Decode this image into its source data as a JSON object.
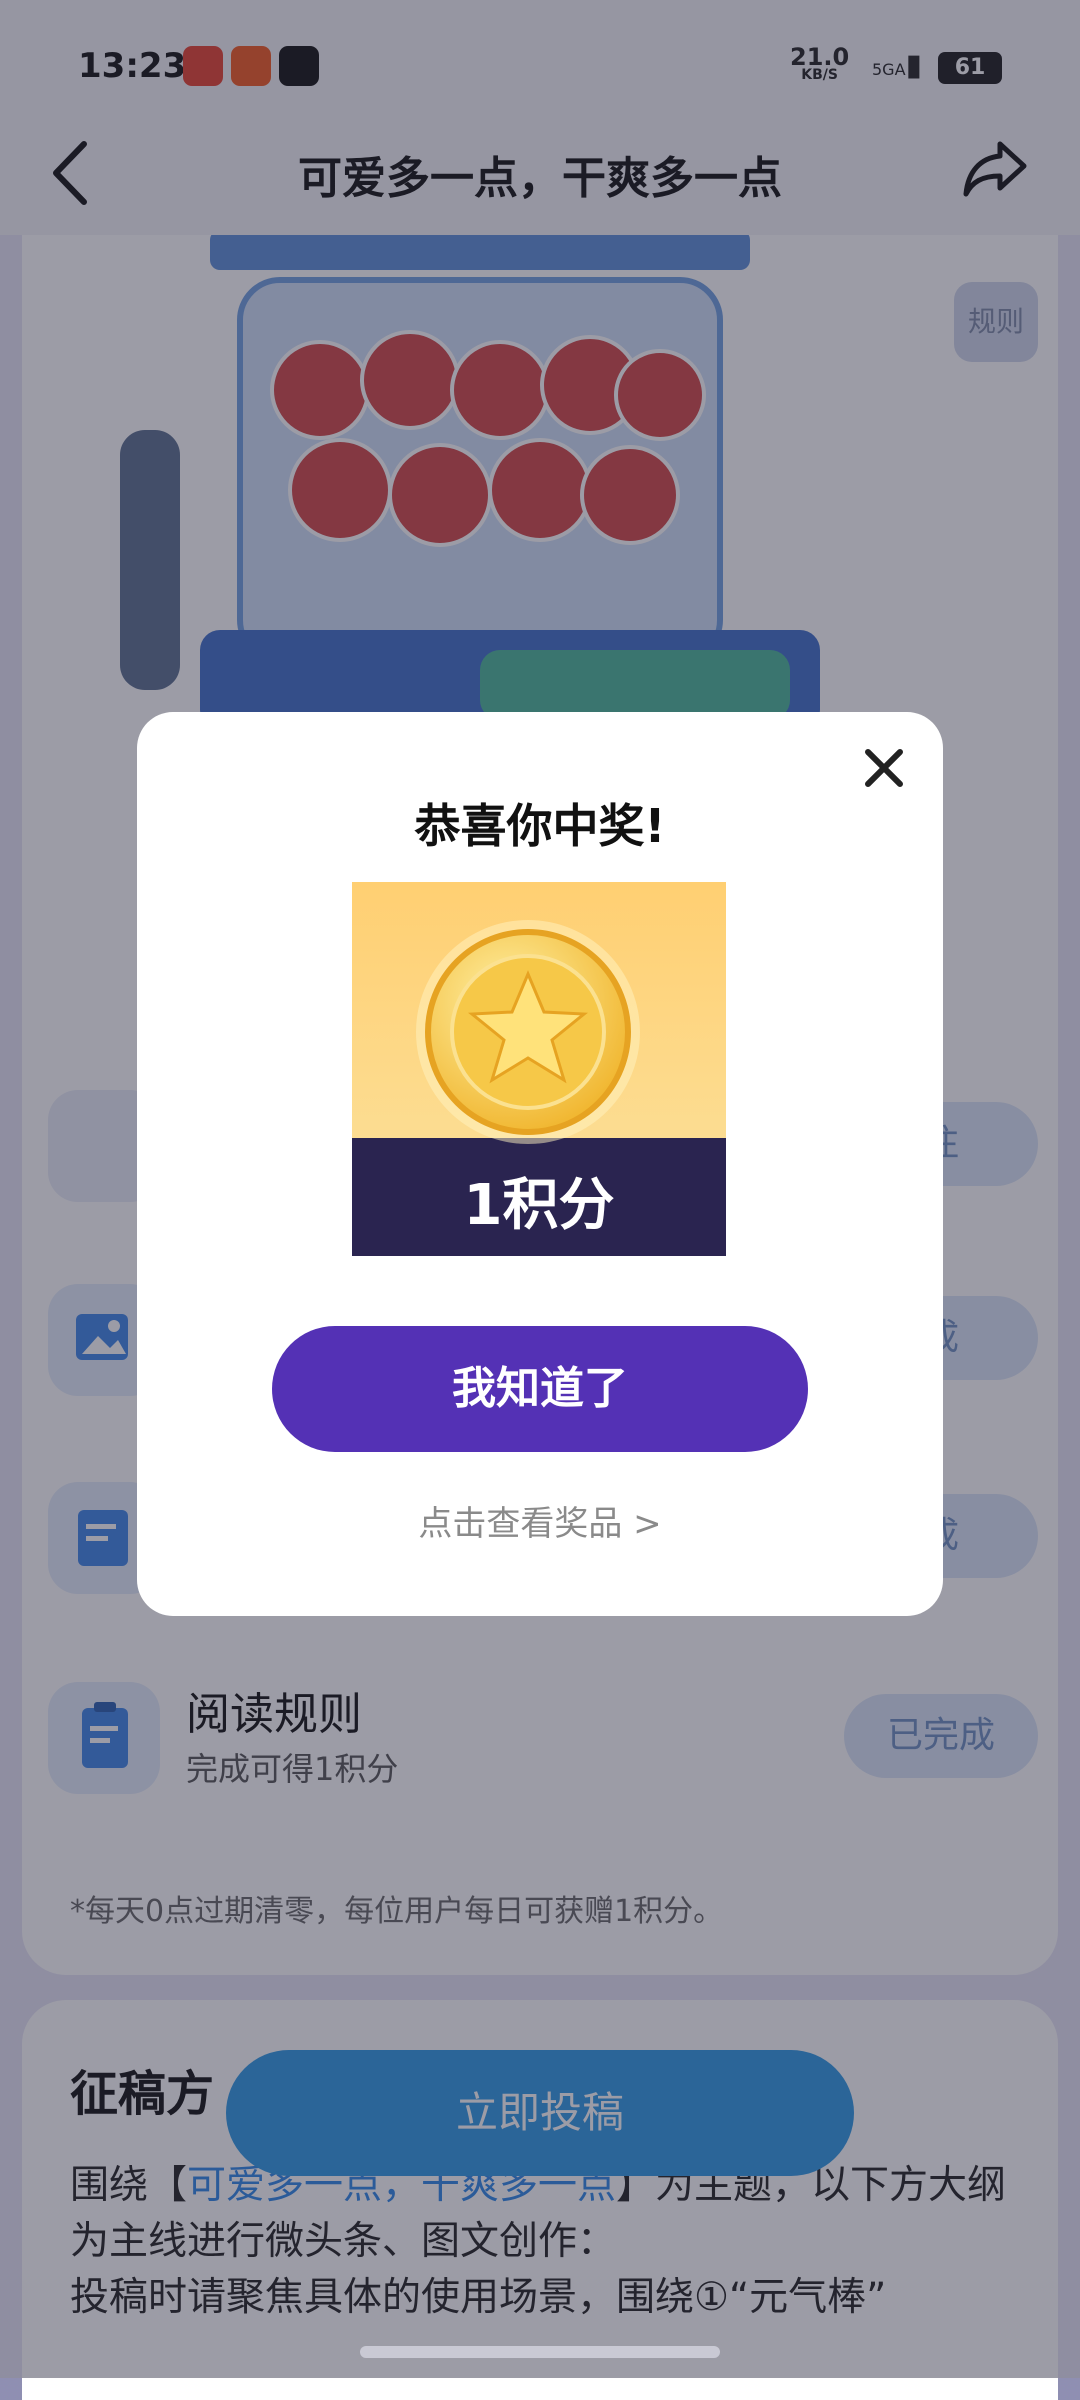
{
  "status_bar": {
    "time": "13:23",
    "net_speed": "21.0",
    "net_unit": "KB/S",
    "signal": "5GA",
    "battery": "61"
  },
  "header": {
    "title": "可爱多一点，干爽多一点"
  },
  "machine": {
    "rules_label": "规则"
  },
  "tasks": [
    {
      "label": "阅读规则",
      "sub": "完成可得1积分",
      "status": "已完成"
    }
  ],
  "partial_status_labels": [
    "注",
    "成",
    "成"
  ],
  "note": "*每天0点过期清零，每位用户每日可获赠1积分。",
  "submission": {
    "title": "征稿方",
    "submit_label": "立即投稿",
    "text_prefix": "围绕【",
    "text_highlight": "可爱多一点，干爽多一点",
    "text_suffix": "】为主题，以下方大纲为主线进行微头条、图文创作：",
    "text_line3": "投稿时请聚焦具体的使用场景，围绕①“元气棒”"
  },
  "modal": {
    "title": "恭喜你中奖!",
    "prize_label": "1积分",
    "ok_label": "我知道了",
    "view_link": "点击查看奖品 >"
  },
  "colors": {
    "accent": "#5431b5",
    "submit": "#2f9ae6",
    "link": "#2f87e8"
  }
}
